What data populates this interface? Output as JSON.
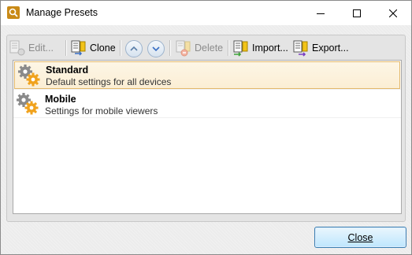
{
  "window": {
    "title": "Manage Presets"
  },
  "toolbar": {
    "edit_label": "Edit...",
    "clone_label": "Clone",
    "delete_label": "Delete",
    "import_label": "Import...",
    "export_label": "Export..."
  },
  "presets": [
    {
      "name": "Standard",
      "description": "Default settings for all devices",
      "selected": true
    },
    {
      "name": "Mobile",
      "description": "Settings for mobile viewers",
      "selected": false
    }
  ],
  "footer": {
    "close_label": "Close"
  },
  "colors": {
    "selection_fill": "#fbeed4",
    "selection_border": "#e3b86a",
    "app_icon": "#c98a17",
    "default_button_border": "#3c7fb1"
  }
}
